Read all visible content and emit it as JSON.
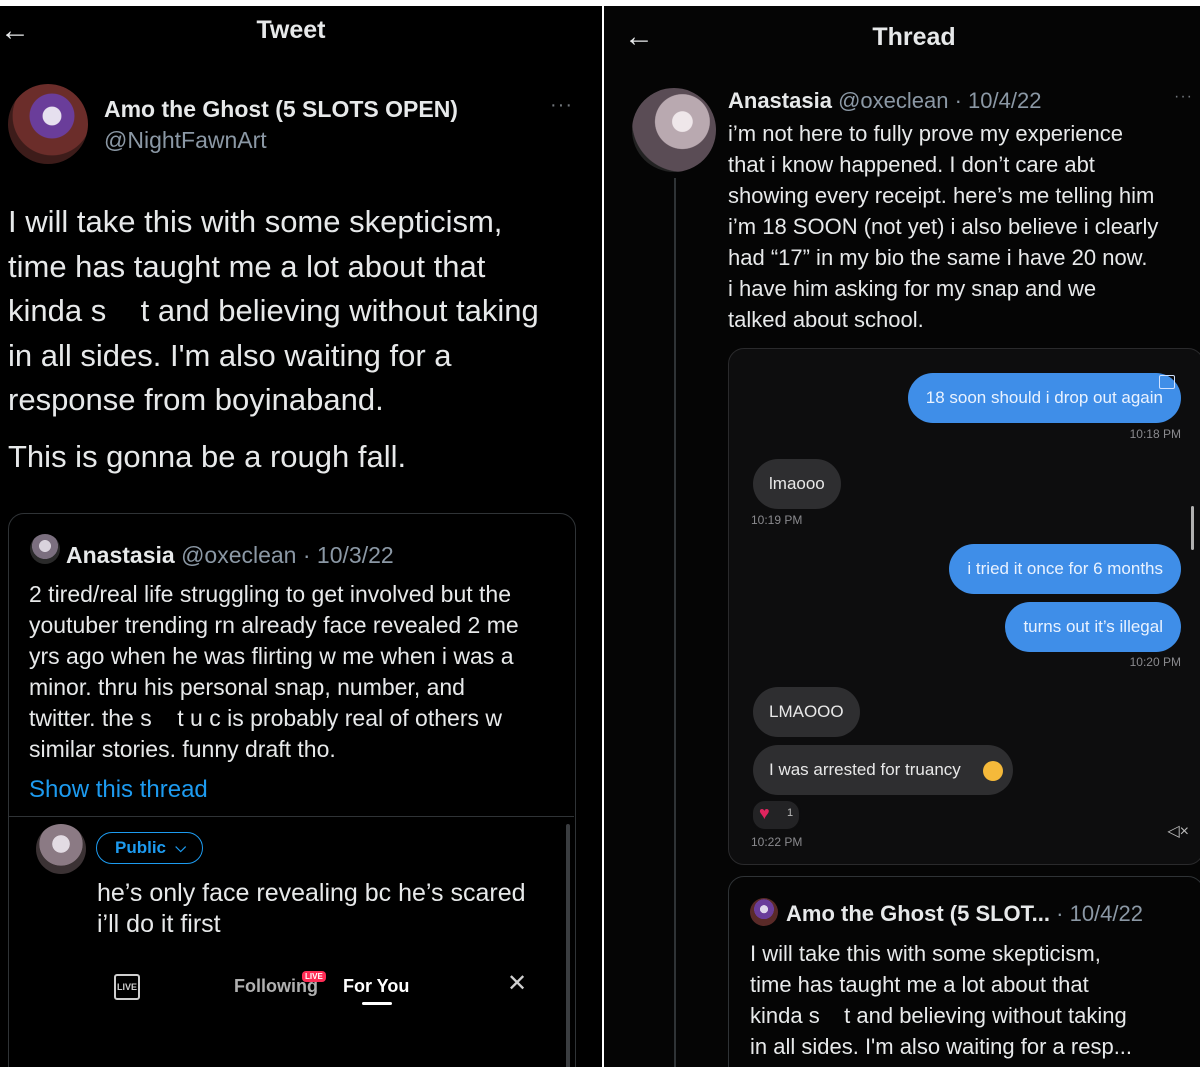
{
  "left": {
    "header_title": "Tweet",
    "author": {
      "name": "Amo the Ghost (5 SLOTS OPEN)",
      "handle": "@NightFawnArt"
    },
    "body_lines": [
      "I will take this with some skepticism,",
      "time has taught me a lot about that",
      "kinda s    t and believing without taking",
      "in all sides. I'm also waiting for a",
      "response from boyinaband."
    ],
    "body_last": "This is gonna be a rough fall.",
    "quote": {
      "name": "Anastasia",
      "handle": "@oxeclean",
      "date": "· 10/3/22",
      "lines": [
        "2 tired/real life struggling to get involved but the",
        "youtuber trending rn already face revealed 2 me",
        "yrs ago when he was flirting w me when i was a",
        "minor. thru his personal snap, number, and",
        "twitter. the s    t u c is probably real of others w",
        "similar stories. funny draft tho."
      ],
      "show_thread": "Show this thread"
    },
    "reply_audience": "Public",
    "reply_lines": [
      "he’s only face revealing bc he’s scared",
      "i’ll do it first"
    ],
    "bottom_nav": {
      "live_icon": "LIVE",
      "following": "Following",
      "live_badge": "LIVE",
      "for_you": "For You"
    }
  },
  "right": {
    "header_title": "Thread",
    "author": {
      "name": "Anastasia",
      "handle": "@oxeclean",
      "date": "· 10/4/22"
    },
    "body_lines": [
      "i’m not here to fully prove my experience",
      "that i know happened. I don’t care abt",
      "showing every receipt. here’s me telling him",
      "i’m 18 SOON (not yet) i also believe i clearly",
      "had “17” in my bio the same i have 20 now.",
      "i have him asking for my snap and we",
      "talked about school."
    ],
    "messages": {
      "m1": "18 soon should i drop out again",
      "t1": "10:18 PM",
      "m2": "lmaooo",
      "t2": "10:19 PM",
      "m3": "i tried it once for 6 months",
      "m4": "turns out it’s illegal",
      "t3": "10:20 PM",
      "m5": "LMAOOO",
      "m6": "I was arrested for truancy",
      "reaction_count": "1",
      "t4": "10:22 PM"
    },
    "quote": {
      "name": "Amo the Ghost (5 SLOT...",
      "date": "· 10/4/22",
      "lines": [
        "I will take this with some skepticism,",
        "time has taught me a lot about that",
        "kinda s    t and believing without taking",
        "in all sides. I'm also waiting for a resp..."
      ]
    }
  },
  "colors": {
    "background": "#000000",
    "link": "#1d9bf0",
    "blue_bubble": "#3f8ee8",
    "grey_bubble": "#2e2e30"
  }
}
